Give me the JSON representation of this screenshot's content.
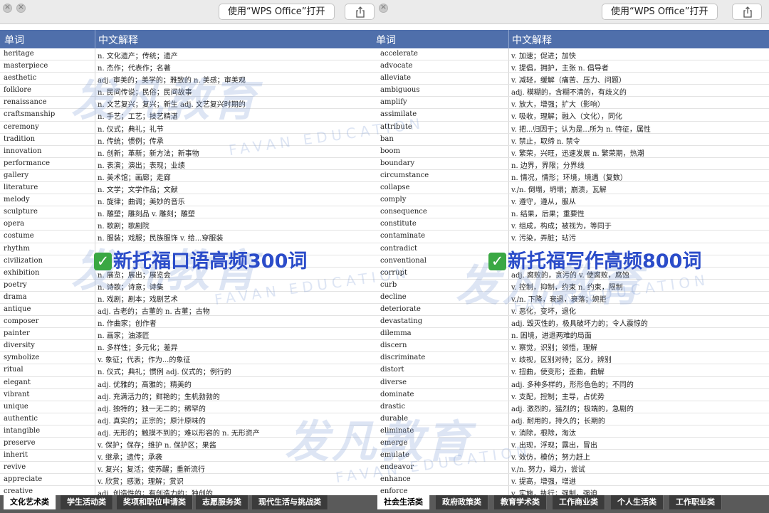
{
  "left_window": {
    "open_button_label": "使用“WPS Office”打开",
    "share_icon": "share-icon",
    "columns": [
      "单词",
      "中文解释"
    ],
    "rows": [
      [
        "heritage",
        "n. 文化遗产；传统；遗产"
      ],
      [
        "masterpiece",
        "n. 杰作；代表作；名著"
      ],
      [
        "aesthetic",
        "adj. 审美的；美学的；雅致的 n. 美感；审美观"
      ],
      [
        "folklore",
        "n. 民间传说；民俗；民间故事"
      ],
      [
        "renaissance",
        "n. 文艺复兴；复兴；新生 adj. 文艺复兴时期的"
      ],
      [
        "craftsmanship",
        "n. 手艺；工艺；技艺精湛"
      ],
      [
        "ceremony",
        "n. 仪式；典礼；礼节"
      ],
      [
        "tradition",
        "n. 传统；惯例；传承"
      ],
      [
        "innovation",
        "n. 创新；革新；新方法；新事物"
      ],
      [
        "performance",
        "n. 表演；演出；表现；业绩"
      ],
      [
        "gallery",
        "n. 美术馆；画廊；走廊"
      ],
      [
        "literature",
        "n. 文学；文学作品；文献"
      ],
      [
        "melody",
        "n. 旋律；曲调；美妙的音乐"
      ],
      [
        "sculpture",
        "n. 雕塑；雕刻品 v. 雕刻；雕塑"
      ],
      [
        "opera",
        "n. 歌剧；歌剧院"
      ],
      [
        "costume",
        "n. 服装；戏服；民族服饰 v. 给...穿服装"
      ],
      [
        "rhythm",
        ""
      ],
      [
        "civilization",
        ""
      ],
      [
        "exhibition",
        "n. 展览；展出；展览会"
      ],
      [
        "poetry",
        "n. 诗歌；诗意；诗集"
      ],
      [
        "drama",
        "n. 戏剧；剧本；戏剧艺术"
      ],
      [
        "antique",
        "adj. 古老的；古董的 n. 古董；古物"
      ],
      [
        "composer",
        "n. 作曲家；创作者"
      ],
      [
        "painter",
        "n. 画家；油漆匠"
      ],
      [
        "diversity",
        "n. 多样性；多元化；差异"
      ],
      [
        "symbolize",
        "v. 象征；代表；作为...的象征"
      ],
      [
        "ritual",
        "n. 仪式；典礼；惯例 adj. 仪式的；例行的"
      ],
      [
        "elegant",
        "adj. 优雅的；高雅的；精美的"
      ],
      [
        "vibrant",
        "adj. 充满活力的；鲜艳的；生机勃勃的"
      ],
      [
        "unique",
        "adj. 独特的；独一无二的；稀罕的"
      ],
      [
        "authentic",
        "adj. 真实的；正宗的；原汁原味的"
      ],
      [
        "intangible",
        "adj. 无形的；触摸不到的；难以形容的 n. 无形资产"
      ],
      [
        "preserve",
        "v. 保护；保存；维护 n. 保护区；果酱"
      ],
      [
        "inherit",
        "v. 继承；遗传；承袭"
      ],
      [
        "revive",
        "v. 复兴；复活；使苏醒；重新流行"
      ],
      [
        "appreciate",
        "v. 欣赏；感激；理解；赏识"
      ],
      [
        "creative",
        "adj. 创造性的；有创造力的；独创的"
      ]
    ],
    "tabs": [
      "文化艺术类",
      "学生活动类",
      "奖项和职位申请类",
      "志愿服务类",
      "现代生活与挑战类"
    ],
    "overlay_label": "新托福口语高频300词"
  },
  "right_window": {
    "open_button_label": "使用“WPS Office”打开",
    "share_icon": "share-icon",
    "columns": [
      "单词",
      "中文解释"
    ],
    "rows": [
      [
        "accelerate",
        "v. 加速；促进；加快"
      ],
      [
        "advocate",
        "v. 提倡，拥护，主张 n. 倡导者"
      ],
      [
        "alleviate",
        "v. 减轻，缓解（痛苦、压力、问题）"
      ],
      [
        "ambiguous",
        "adj. 模糊的，含糊不清的，有歧义的"
      ],
      [
        "amplify",
        "v. 放大，增强；扩大（影响）"
      ],
      [
        "assimilate",
        "v. 吸收，理解；融入（文化），同化"
      ],
      [
        "attribute",
        "v. 把...归因于；认为是...所为 n. 特征，属性"
      ],
      [
        "ban",
        "v. 禁止，取缔 n. 禁令"
      ],
      [
        "boom",
        "v. 繁荣，兴旺，迅速发展 n. 繁荣期，热潮"
      ],
      [
        "boundary",
        "n. 边界，界限；分界线"
      ],
      [
        "circumstance",
        "n. 情况，情形；环境，境遇（复数）"
      ],
      [
        "collapse",
        "v./n. 倒塌，坍塌；崩溃，瓦解"
      ],
      [
        "comply",
        "v. 遵守，遵从，服从"
      ],
      [
        "consequence",
        "n. 结果，后果；重要性"
      ],
      [
        "constitute",
        "v. 组成，构成；被视为，等同于"
      ],
      [
        "contaminate",
        "v. 污染，弄脏；玷污"
      ],
      [
        "contradict",
        ""
      ],
      [
        "conventional",
        ""
      ],
      [
        "corrupt",
        "adj. 腐败的，贪污的 v. 使腐败，腐蚀"
      ],
      [
        "curb",
        "v. 控制，抑制，约束 n. 约束，限制"
      ],
      [
        "decline",
        "v./n. 下降，衰退，衰落；婉拒"
      ],
      [
        "deteriorate",
        "v. 恶化，变坏，退化"
      ],
      [
        "devastating",
        "adj. 毁灭性的，极具破坏力的；令人震惊的"
      ],
      [
        "dilemma",
        "n. 困境，进退两难的局面"
      ],
      [
        "discern",
        "v. 察觉，识别；领悟，理解"
      ],
      [
        "discriminate",
        "v. 歧视，区别对待；区分，辨别"
      ],
      [
        "distort",
        "v. 扭曲，使变形；歪曲，曲解"
      ],
      [
        "diverse",
        "adj. 多种多样的，形形色色的；不同的"
      ],
      [
        "dominate",
        "v. 支配，控制；主导，占优势"
      ],
      [
        "drastic",
        "adj. 激烈的，猛烈的；极端的，急剧的"
      ],
      [
        "durable",
        "adj. 耐用的，持久的；长期的"
      ],
      [
        "eliminate",
        "v. 消除，根除，淘汰"
      ],
      [
        "emerge",
        "v. 出现，浮现；露出，冒出"
      ],
      [
        "emulate",
        "v. 效仿，模仿；努力赶上"
      ],
      [
        "endeavor",
        "v./n. 努力，竭力，尝试"
      ],
      [
        "enhance",
        "v. 提高，增强，增进"
      ],
      [
        "enforce",
        "v. 实施，执行；强制，强迫"
      ]
    ],
    "tabs": [
      "社会生活类",
      "政府政策类",
      "教育学术类",
      "工作商业类",
      "个人生活类",
      "工作职业类"
    ],
    "overlay_label": "新托福写作高频800词"
  },
  "watermark": {
    "brand_cn": "发凡教育",
    "brand_en": "FAVAN EDUCATION"
  }
}
